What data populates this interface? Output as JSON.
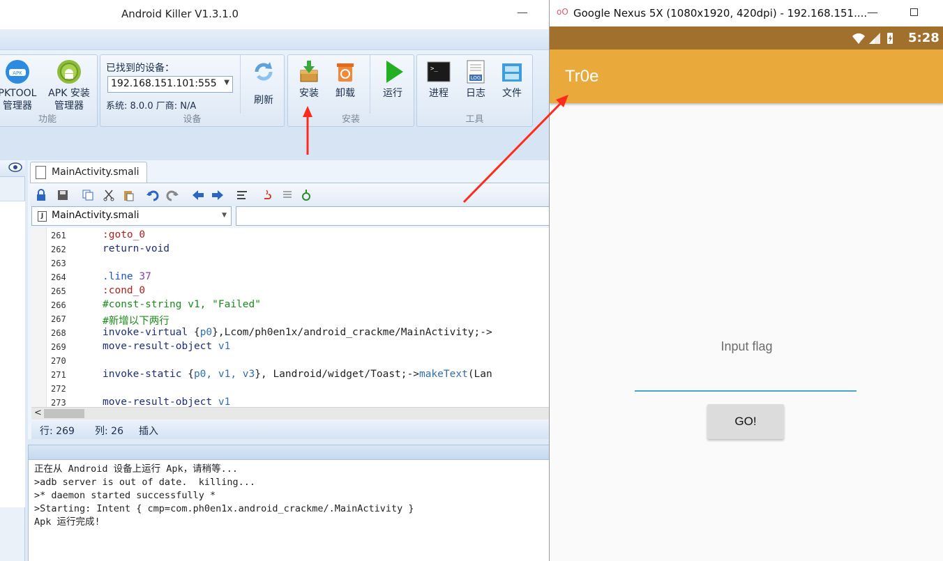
{
  "ak_window": {
    "title": "Android Killer V1.3.1.0",
    "minimize": "—"
  },
  "ribbon": {
    "group_func": {
      "label": "功能",
      "apktool_label": "PKTOOL\n管理器",
      "apktool_l1": "PKTOOL",
      "apktool_l2": "管理器",
      "apk_install_l1": "APK 安装",
      "apk_install_l2": "管理器"
    },
    "group_device": {
      "label": "设备",
      "found_title": "已找到的设备：",
      "device_value": "192.168.151.101:555",
      "device_info": "系统: 8.0.0   厂商: N/A",
      "refresh_label": "刷新"
    },
    "group_install": {
      "label": "安装",
      "install_label": "安装",
      "uninstall_label": "卸载",
      "run_label": "运行"
    },
    "group_tools": {
      "label": "工具",
      "process_label": "进程",
      "log_label": "日志",
      "file_label": "文件"
    }
  },
  "editor": {
    "tab_label": "MainActivity.smali",
    "file_combo": "MainActivity.smali",
    "status": {
      "row": "行: 269",
      "col": "列: 26",
      "mode": "插入"
    },
    "lines": [
      {
        "n": "261",
        "parts": [
          {
            "c": "lbl-red",
            "t": ":goto_0"
          }
        ]
      },
      {
        "n": "262",
        "parts": [
          {
            "c": "kw",
            "t": "return-void"
          }
        ]
      },
      {
        "n": "263",
        "parts": []
      },
      {
        "n": "264",
        "parts": [
          {
            "c": "dir",
            "t": ".line "
          },
          {
            "c": "num",
            "t": "37"
          }
        ]
      },
      {
        "n": "265",
        "parts": [
          {
            "c": "lbl-red",
            "t": ":cond_0"
          }
        ]
      },
      {
        "n": "266",
        "parts": [
          {
            "c": "cm",
            "t": "#const-string v1, \"Failed\""
          }
        ]
      },
      {
        "n": "267",
        "parts": [
          {
            "c": "cm",
            "t": "#新增以下两行"
          }
        ]
      },
      {
        "n": "268",
        "parts": [
          {
            "c": "kw",
            "t": "invoke-virtual "
          },
          {
            "c": "plain",
            "t": "{"
          },
          {
            "c": "reg",
            "t": "p0"
          },
          {
            "c": "plain",
            "t": "},Lcom/ph0en1x/android_crackme/MainActivity;->"
          }
        ]
      },
      {
        "n": "269",
        "parts": [
          {
            "c": "kw",
            "t": "move-result-object "
          },
          {
            "c": "reg",
            "t": "v1"
          }
        ]
      },
      {
        "n": "270",
        "parts": []
      },
      {
        "n": "271",
        "parts": [
          {
            "c": "kw",
            "t": "invoke-static "
          },
          {
            "c": "plain",
            "t": "{"
          },
          {
            "c": "reg",
            "t": "p0, v1, v3"
          },
          {
            "c": "plain",
            "t": "}, Landroid/widget/Toast;->"
          },
          {
            "c": "meth",
            "t": "makeText"
          },
          {
            "c": "plain",
            "t": "(Lan"
          }
        ]
      },
      {
        "n": "272",
        "parts": []
      },
      {
        "n": "273",
        "parts": [
          {
            "c": "kw",
            "t": "move-result-object "
          },
          {
            "c": "reg",
            "t": "v1"
          }
        ]
      }
    ]
  },
  "log": {
    "lines": [
      "正在从 Android 设备上运行 Apk，请稍等...",
      ">adb server is out of date.  killing...",
      ">* daemon started successfully *",
      ">Starting: Intent { cmp=com.ph0en1x.android_crackme/.MainActivity }",
      "Apk 运行完成!"
    ]
  },
  "emulator": {
    "title": "Google Nexus 5X (1080x1920, 420dpi) - 192.168.151....",
    "logo": "oO",
    "time": "5:28",
    "app_title": "Tr0e",
    "prompt": "Input flag",
    "input_value": "",
    "go_label": "GO!"
  },
  "colors": {
    "status_bar": "#a1702d",
    "app_bar": "#e9a93b",
    "input_underline": "#4aa3c8",
    "arrow": "#ff2a1a"
  }
}
